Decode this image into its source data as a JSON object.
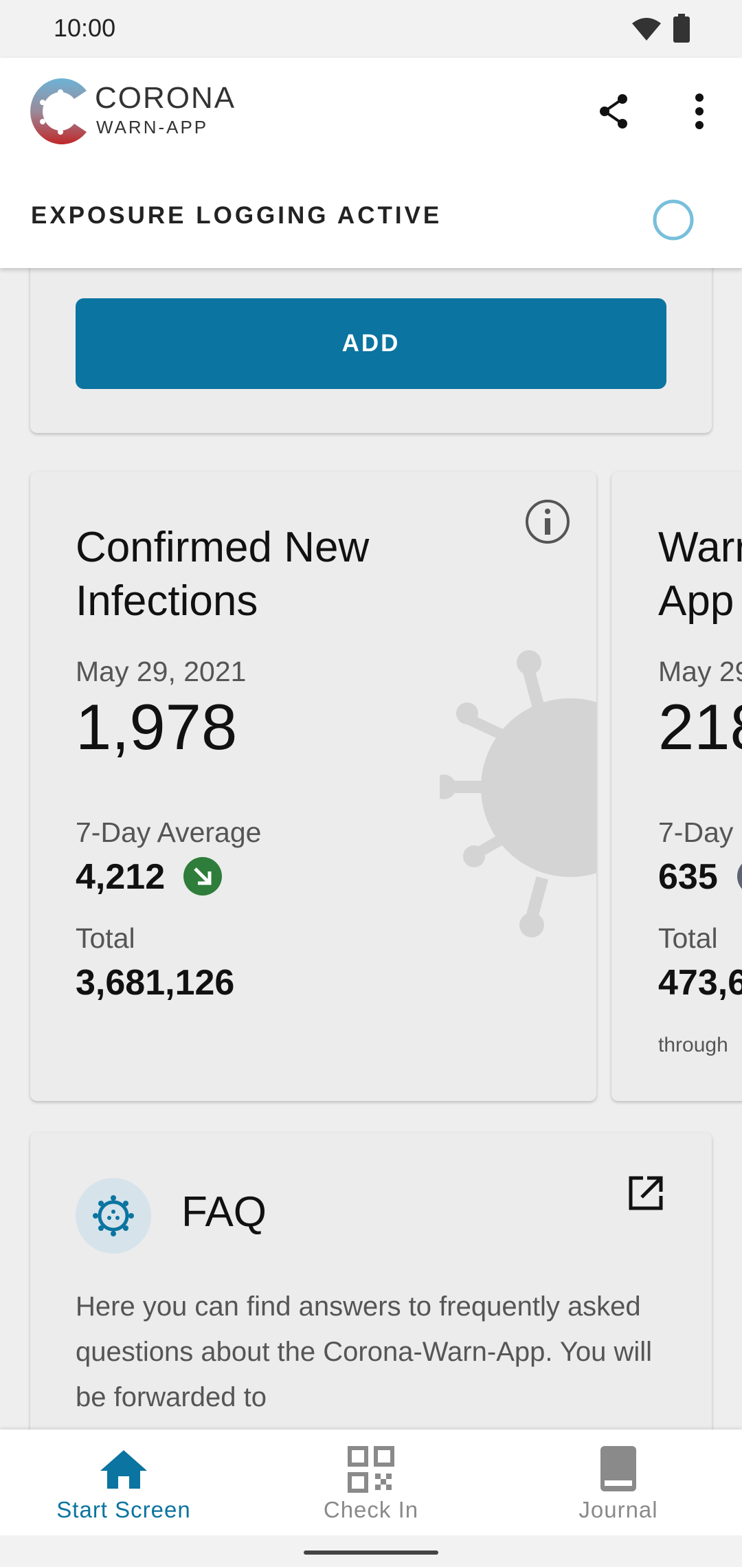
{
  "status_bar": {
    "time": "10:00"
  },
  "app_bar": {
    "logo_title": "CORONA",
    "logo_subtitle": "WARN-APP",
    "share_icon": "share-icon",
    "menu_icon": "more-vert-icon"
  },
  "exposure": {
    "label": "EXPOSURE LOGGING ACTIVE"
  },
  "add_card": {
    "button_label": "ADD"
  },
  "stats": [
    {
      "title_line1": "Confirmed New",
      "title_line2": "Infections",
      "date": "May 29, 2021",
      "value": "1,978",
      "avg_label": "7-Day Average",
      "avg_value": "4,212",
      "total_label": "Total",
      "total_value": "3,681,126"
    },
    {
      "title_line1": "Warr",
      "title_line2": "App",
      "date": "May 29",
      "value": "218",
      "avg_label": "7-Day",
      "avg_value": "635",
      "total_label": "Total",
      "total_value": "473,6",
      "footnote": "through"
    }
  ],
  "faq": {
    "title": "FAQ",
    "text": "Here you can find answers to frequently asked questions about the Corona-Warn-App. You will be forwarded to"
  },
  "bottom_nav": {
    "items": [
      {
        "label": "Start Screen",
        "icon": "home-icon",
        "active": true
      },
      {
        "label": "Check In",
        "icon": "qr-code-icon",
        "active": false
      },
      {
        "label": "Journal",
        "icon": "book-icon",
        "active": false
      }
    ]
  },
  "colors": {
    "primary": "#0b74a0",
    "trend_down": "#2e7d3a",
    "active_nav": "#0b74a0",
    "inactive_nav": "#8a8a8a"
  }
}
